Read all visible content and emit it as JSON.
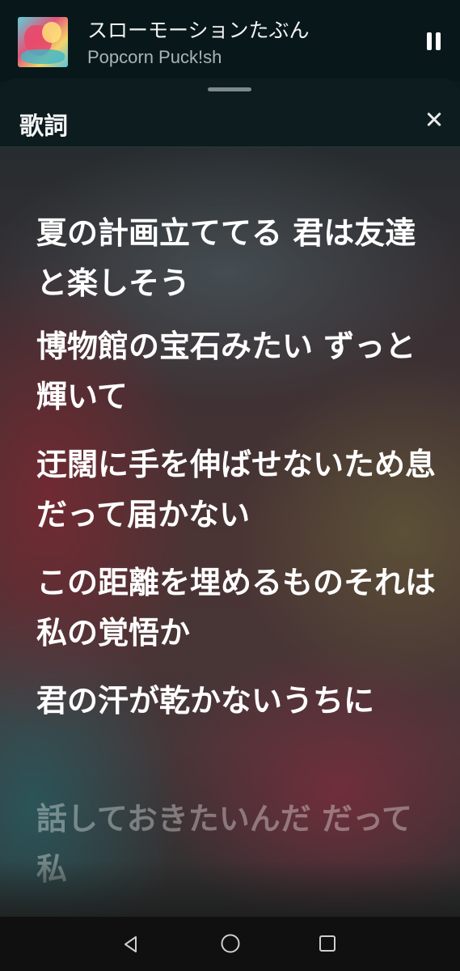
{
  "player": {
    "song_title": "スローモーションたぶん",
    "artist": "Popcorn Puck!sh"
  },
  "lyrics_sheet": {
    "title": "歌詞",
    "lines": [
      "夏の計画立ててる 君は友達と楽しそう",
      "博物館の宝石みたい ずっと輝いて",
      "迂闊に手を伸ばせないため息だって届かない",
      "この距離を埋めるものそれは私の覚悟か",
      "君の汗が乾かないうちに",
      "話しておきたいんだ だって私"
    ]
  },
  "icons": {
    "pause": "pause-icon",
    "close": "close-icon",
    "back": "back-triangle-icon",
    "home": "home-circle-icon",
    "recents": "recents-square-icon"
  }
}
